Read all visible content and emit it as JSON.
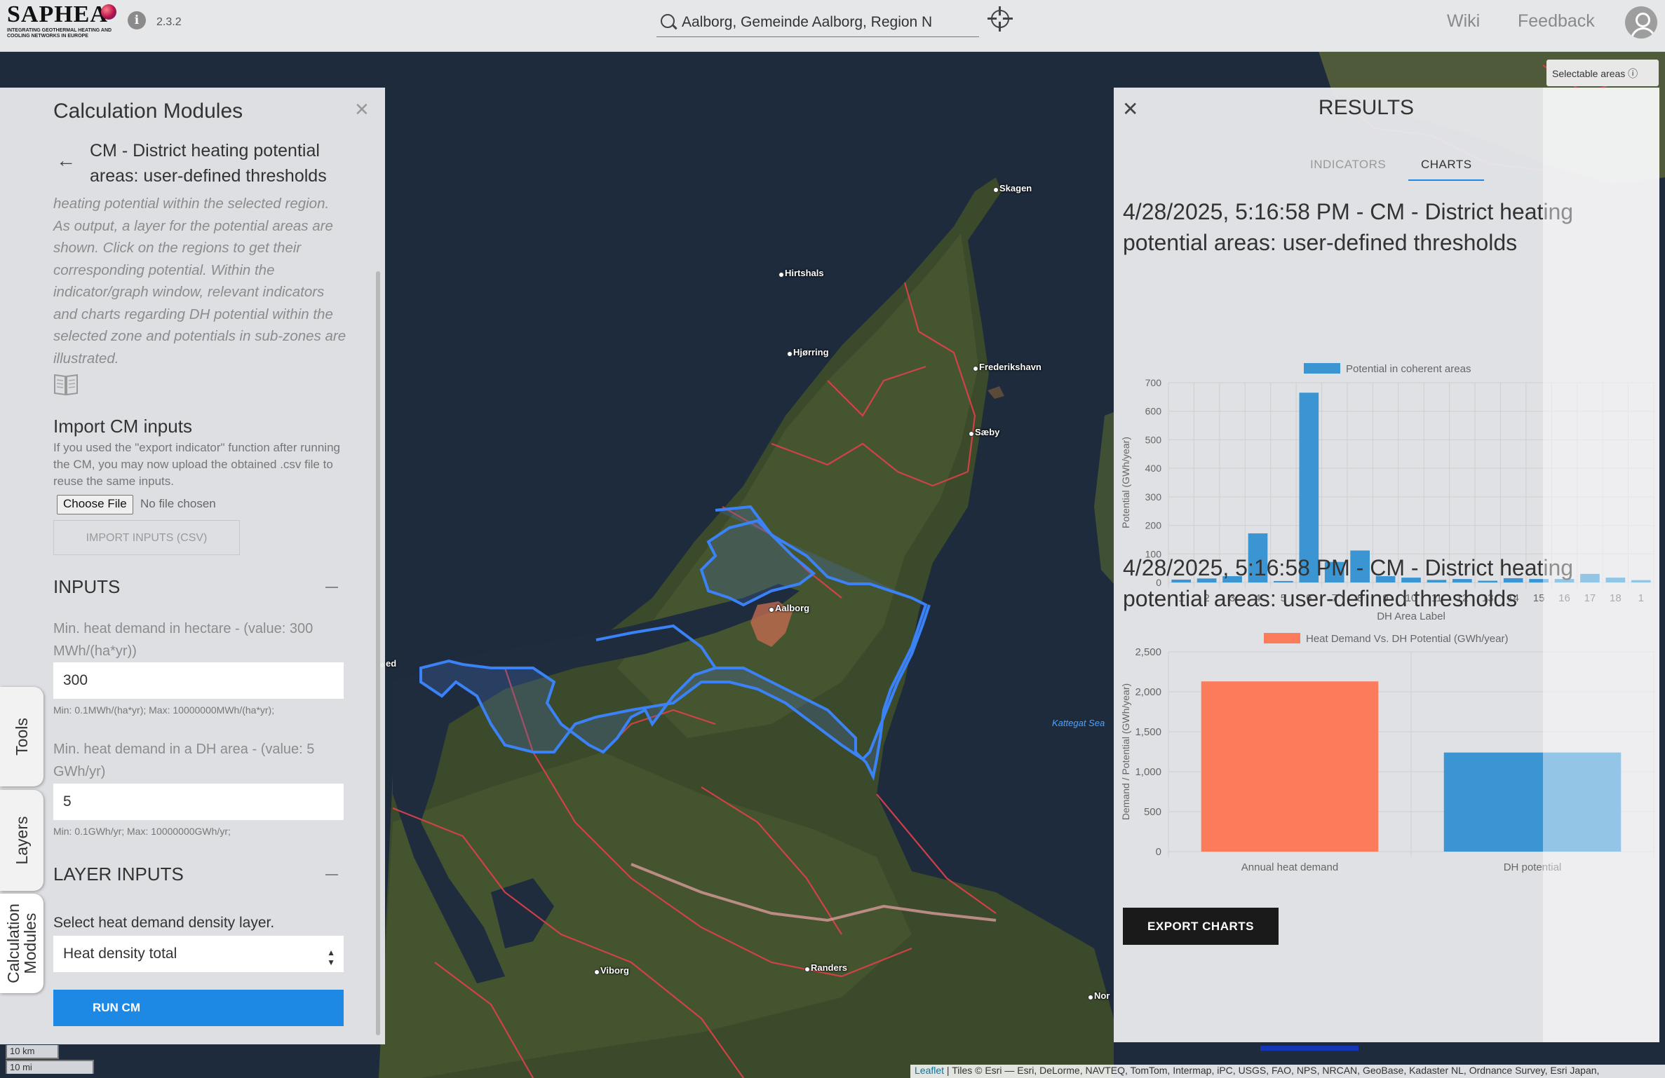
{
  "header": {
    "logo": "SAPHEA",
    "logo_sub": "INTEGRATING GEOTHERMAL HEATING AND COOLING NETWORKS IN EUROPE",
    "version": "2.3.2",
    "search_value": "Aalborg, Gemeinde Aalborg, Region N",
    "nav": {
      "wiki": "Wiki",
      "feedback": "Feedback"
    }
  },
  "map": {
    "selectable_areas": "Selectable areas ⓘ",
    "towns": [
      "Skagen",
      "Hirtshals",
      "Hjørring",
      "Frederikshavn",
      "Sæby",
      "Aalborg",
      "Viborg",
      "Randers",
      "Nor",
      "ed"
    ],
    "sea_label": "Kattegat Sea",
    "scale_km": "10 km",
    "scale_mi": "10 mi",
    "attribution_leaflet": "Leaflet",
    "attribution_text": " | Tiles © Esri — Esri, DeLorme, NAVTEQ, TomTom, Intermap, iPC, USGS, FAO, NPS, NRCAN, GeoBase, Kadaster NL, Ordnance Survey, Esri Japan,"
  },
  "side_tabs": {
    "tools": "Tools",
    "layers": "Layers",
    "cm": "Calculation Modules"
  },
  "cm_panel": {
    "title": "Calculation Modules",
    "subtitle": "CM - District heating potential areas: user-defined thresholds",
    "description": "heating potential within the selected region. As output, a layer for the potential areas are shown. Click on the regions to get their corresponding potential. Within the indicator/graph window, relevant indicators and charts regarding DH potential within the selected zone and potentials in sub-zones are illustrated.",
    "import_heading": "Import CM inputs",
    "import_text": "If you used the \"export indicator\" function after running the CM, you may now upload the obtained .csv file to reuse the same inputs.",
    "choose_file": "Choose File",
    "no_file": "No file chosen",
    "import_button": "IMPORT INPUTS (CSV)",
    "inputs_heading": "INPUTS",
    "field1_label": "Min. heat demand in hectare - (value: 300 MWh/(ha*yr))",
    "field1_value": "300",
    "field1_hint": "Min: 0.1MWh/(ha*yr); Max: 10000000MWh/(ha*yr);",
    "field2_label": "Min. heat demand in a DH area - (value: 5 GWh/yr)",
    "field2_value": "5",
    "field2_hint": "Min: 0.1GWh/yr; Max: 10000000GWh/yr;",
    "layer_inputs_heading": "LAYER INPUTS",
    "select_label": "Select heat demand density layer.",
    "select_value": "Heat density total",
    "run_button": "RUN CM"
  },
  "results": {
    "title": "RESULTS",
    "tab_indicators": "INDICATORS",
    "tab_charts": "CHARTS",
    "chart1_heading": "4/28/2025, 5:16:58 PM - CM - District heating potential areas: user-defined thresholds",
    "chart2_heading": "4/28/2025, 5:16:58 PM - CM - District heating potential areas: user-defined thresholds",
    "export_button": "EXPORT CHARTS"
  },
  "chart_data": [
    {
      "type": "bar",
      "legend": "Potential in coherent areas",
      "legend_position": "top",
      "xlabel": "DH Area Label",
      "ylabel": "Potential (GWh/year)",
      "ylim": [
        0,
        700
      ],
      "yticks": [
        0,
        100,
        200,
        300,
        400,
        500,
        600,
        700
      ],
      "color": "#3b95d3",
      "grid": true,
      "categories": [
        "1",
        "2",
        "3",
        "4",
        "5",
        "6",
        "7",
        "8",
        "9",
        "10",
        "11",
        "12",
        "13",
        "14",
        "15",
        "16",
        "17",
        "18",
        "1"
      ],
      "values": [
        10,
        14,
        22,
        172,
        5,
        665,
        72,
        112,
        22,
        17,
        9,
        12,
        6,
        15,
        12,
        12,
        30,
        17,
        8
      ]
    },
    {
      "type": "bar",
      "legend": "Heat Demand Vs. DH Potential (GWh/year)",
      "legend_position": "top",
      "ylabel": "Demand / Potential (GWh/year)",
      "ylim": [
        0,
        2500
      ],
      "yticks": [
        "0",
        "500",
        "1,000",
        "1,500",
        "2,000",
        "2,500"
      ],
      "grid": true,
      "categories": [
        "Annual heat demand",
        "DH potential"
      ],
      "values": [
        2130,
        1240
      ],
      "colors": [
        "#fb7b5a",
        "#3b95d3"
      ]
    }
  ]
}
